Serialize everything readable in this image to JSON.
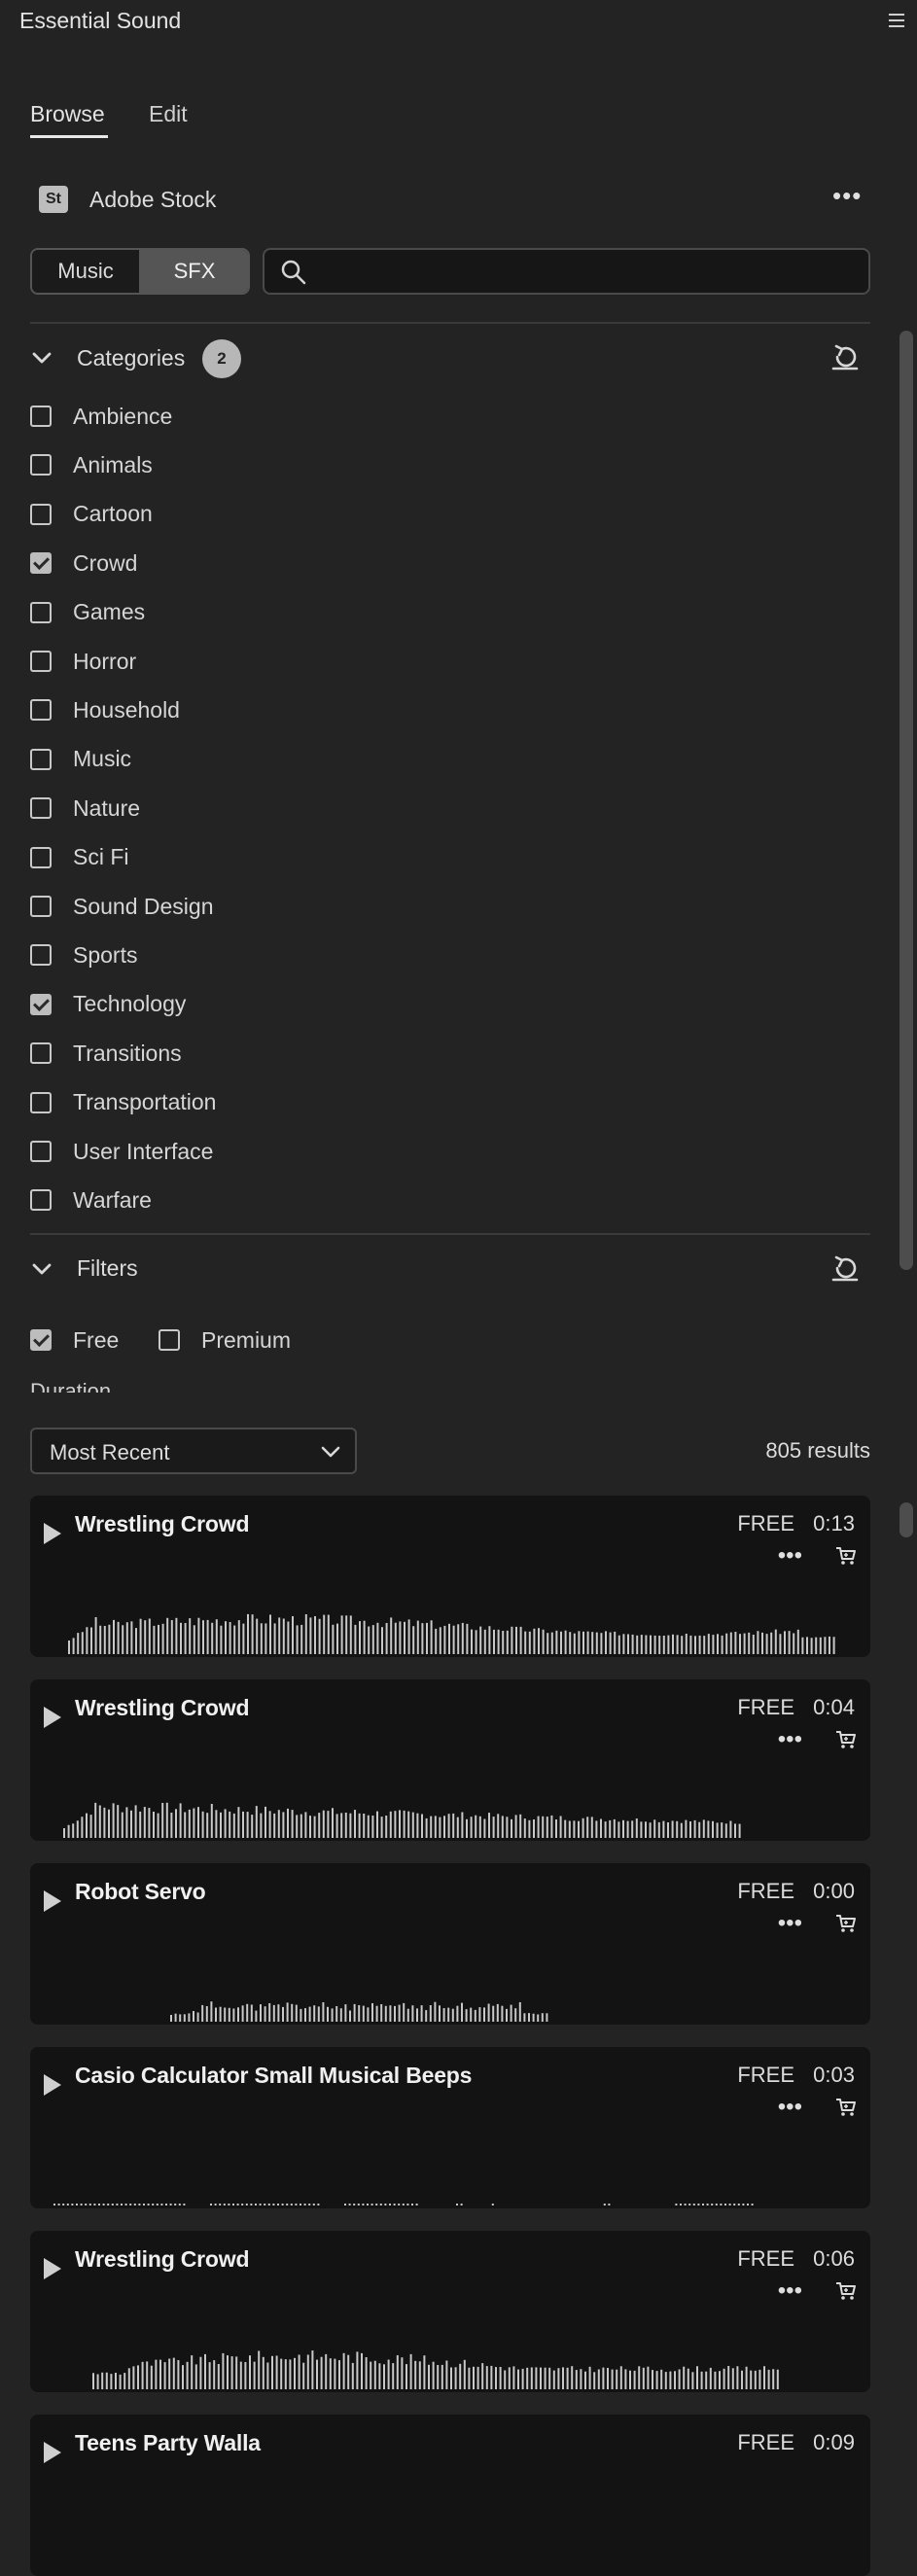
{
  "window": {
    "title": "Essential Sound"
  },
  "tabs": {
    "browse": "Browse",
    "edit": "Edit"
  },
  "source": {
    "badge": "St",
    "label": "Adobe Stock"
  },
  "segment": {
    "music": "Music",
    "sfx": "SFX",
    "active": "SFX"
  },
  "search": {
    "value": "",
    "placeholder": ""
  },
  "categories": {
    "label": "Categories",
    "selected_count": "2",
    "items": [
      {
        "label": "Ambience",
        "checked": false
      },
      {
        "label": "Animals",
        "checked": false
      },
      {
        "label": "Cartoon",
        "checked": false
      },
      {
        "label": "Crowd",
        "checked": true
      },
      {
        "label": "Games",
        "checked": false
      },
      {
        "label": "Horror",
        "checked": false
      },
      {
        "label": "Household",
        "checked": false
      },
      {
        "label": "Music",
        "checked": false
      },
      {
        "label": "Nature",
        "checked": false
      },
      {
        "label": "Sci Fi",
        "checked": false
      },
      {
        "label": "Sound Design",
        "checked": false
      },
      {
        "label": "Sports",
        "checked": false
      },
      {
        "label": "Technology",
        "checked": true
      },
      {
        "label": "Transitions",
        "checked": false
      },
      {
        "label": "Transportation",
        "checked": false
      },
      {
        "label": "User Interface",
        "checked": false
      },
      {
        "label": "Warfare",
        "checked": false
      }
    ]
  },
  "filters": {
    "label": "Filters",
    "free": {
      "label": "Free",
      "checked": true
    },
    "premium": {
      "label": "Premium",
      "checked": false
    },
    "duration_label": "Duration"
  },
  "sort": {
    "value": "Most Recent"
  },
  "results_label": "805 results",
  "colors": {
    "background": "#232323",
    "card": "#131313",
    "waveform": "#c8c8c8"
  },
  "tracks": [
    {
      "title": "Wrestling Crowd",
      "price": "FREE",
      "duration": "0:13"
    },
    {
      "title": "Wrestling Crowd",
      "price": "FREE",
      "duration": "0:04"
    },
    {
      "title": "Robot Servo",
      "price": "FREE",
      "duration": "0:00"
    },
    {
      "title": "Casio Calculator Small Musical Beeps",
      "price": "FREE",
      "duration": "0:03"
    },
    {
      "title": "Wrestling Crowd",
      "price": "FREE",
      "duration": "0:06"
    },
    {
      "title": "Teens Party Walla",
      "price": "FREE",
      "duration": "0:09"
    }
  ]
}
